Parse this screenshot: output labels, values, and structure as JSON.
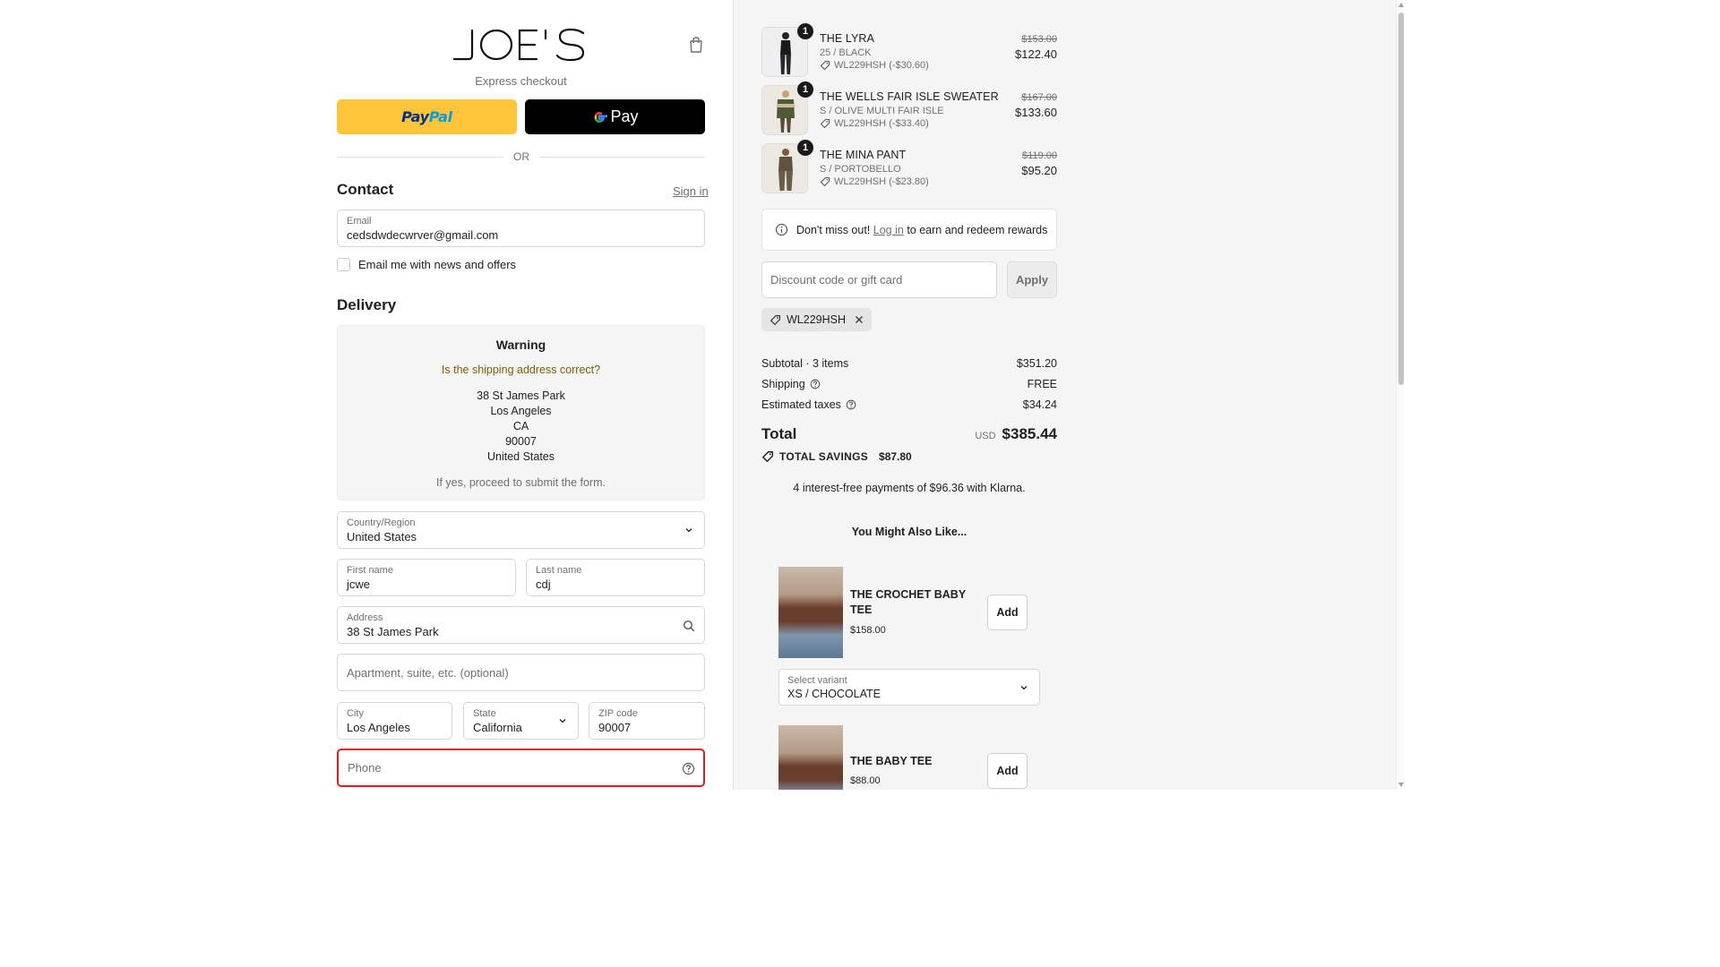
{
  "brand": {
    "logo_text": "JOE'S"
  },
  "express": {
    "label": "Express checkout",
    "paypal_label": "PayPal",
    "gpay_label": "Pay"
  },
  "divider": {
    "or": "OR"
  },
  "contact": {
    "heading": "Contact",
    "signin": "Sign in",
    "email_label": "Email",
    "email_value": "cedsdwdecwrver@gmail.com",
    "newsletter_label": "Email me with news and offers"
  },
  "delivery": {
    "heading": "Delivery",
    "warning": {
      "title": "Warning",
      "question": "Is the shipping address correct?",
      "address_lines": [
        "38 St James Park",
        "Los Angeles",
        "CA",
        "90007",
        "United States"
      ],
      "footer": "If yes, proceed to submit the form."
    },
    "country_label": "Country/Region",
    "country_value": "United States",
    "first_name_label": "First name",
    "first_name_value": "jcwe",
    "last_name_label": "Last name",
    "last_name_value": "cdj",
    "address_label": "Address",
    "address_value": "38 St James Park",
    "apartment_placeholder": "Apartment, suite, etc. (optional)",
    "city_label": "City",
    "city_value": "Los Angeles",
    "state_label": "State",
    "state_value": "California",
    "zip_label": "ZIP code",
    "zip_value": "90007",
    "phone_placeholder": "Phone"
  },
  "cart": {
    "items": [
      {
        "qty": "1",
        "name": "THE LYRA",
        "variant": "25 / BLACK",
        "discount": "WL229HSH (-$30.60)",
        "old_price": "$153.00",
        "price": "$122.40"
      },
      {
        "qty": "1",
        "name": "THE WELLS FAIR ISLE SWEATER",
        "variant": "S / OLIVE MULTI FAIR ISLE",
        "discount": "WL229HSH (-$33.40)",
        "old_price": "$167.00",
        "price": "$133.60"
      },
      {
        "qty": "1",
        "name": "THE MINA PANT",
        "variant": "S / PORTOBELLO",
        "discount": "WL229HSH (-$23.80)",
        "old_price": "$119.00",
        "price": "$95.20"
      }
    ]
  },
  "rewards": {
    "before": "Don't miss out!",
    "link": "Log in",
    "after": "to earn and redeem rewards"
  },
  "discount": {
    "placeholder": "Discount code or gift card",
    "apply": "Apply",
    "applied_code": "WL229HSH"
  },
  "summary": {
    "subtotal_label": "Subtotal · 3 items",
    "subtotal_value": "$351.20",
    "shipping_label": "Shipping",
    "shipping_value": "FREE",
    "taxes_label": "Estimated taxes",
    "taxes_value": "$34.24",
    "total_label": "Total",
    "currency": "USD",
    "total_value": "$385.44",
    "savings_label": "TOTAL SAVINGS",
    "savings_value": "$87.80",
    "klarna": "4 interest-free payments of $96.36 with Klarna."
  },
  "recommendations": {
    "heading": "You Might Also Like...",
    "items": [
      {
        "name": "THE CROCHET BABY TEE",
        "price": "$158.00",
        "add": "Add",
        "variant_label": "Select variant",
        "variant_value": "XS / CHOCOLATE"
      },
      {
        "name": "THE BABY TEE",
        "price": "$88.00",
        "add": "Add"
      }
    ]
  },
  "colors": {
    "paypal_yellow": "#ffc439",
    "gpay_black": "#000000",
    "error_red": "#dd1d1d",
    "warning_text": "#7a5f00"
  }
}
